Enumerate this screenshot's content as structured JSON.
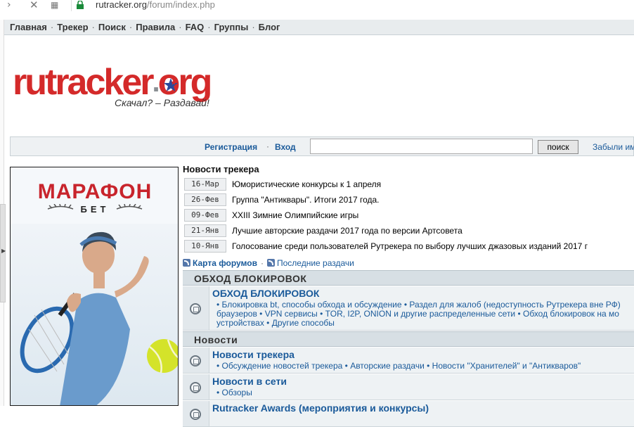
{
  "browser": {
    "url_host": "rutracker.org",
    "url_path": "/forum/index.php"
  },
  "topmenu": {
    "items": [
      "Главная",
      "Трекер",
      "Поиск",
      "Правила",
      "FAQ",
      "Группы",
      "Блог"
    ]
  },
  "logo": {
    "text_red": "rutracker",
    "text_grey": "org",
    "slogan": "Скачал? – Раздавай!"
  },
  "loginbar": {
    "register": "Регистрация",
    "login": "Вход",
    "search_button": "поиск",
    "forgot": "Забыли им"
  },
  "ad": {
    "brand": "МАРАФОН",
    "sub": "БЕТ"
  },
  "news": {
    "heading": "Новости трекера",
    "items": [
      {
        "date": "16-Мар",
        "title": "Юмористические конкурсы к 1 апреля"
      },
      {
        "date": "26-Фев",
        "title": "Группа \"Антиквары\". Итоги 2017 года."
      },
      {
        "date": "09-Фев",
        "title": "XXIII Зимние Олимпийские игры"
      },
      {
        "date": "21-Янв",
        "title": "Лучшие авторские раздачи 2017 года по версии Артсовета"
      },
      {
        "date": "10-Янв",
        "title": "Голосование среди пользователей Рутрекера по выбору лучших джазовых изданий 2017 г"
      }
    ]
  },
  "maplinks": {
    "forum_map": "Карта форумов",
    "latest": "Последние раздачи"
  },
  "categories": [
    {
      "title": "ОБХОД БЛОКИРОВОК",
      "forums": [
        {
          "name": "ОБХОД БЛОКИРОВОК",
          "lines": [
            "• Блокировка bt, способы обхода и обсуждение • Раздел для жалоб (недоступность Рутрекера вне РФ)",
            "браузеров • VPN сервисы • TOR, I2P, ONION и другие распределенные сети • Обход блокировок на мо",
            "устройствах • Другие способы"
          ]
        }
      ]
    },
    {
      "title": "Новости",
      "forums": [
        {
          "name": "Новости трекера",
          "lines": [
            "• Обсуждение новостей трекера • Авторские раздачи • Новости \"Хранителей\" и \"Антикваров\""
          ]
        },
        {
          "name": "Новости в сети",
          "lines": [
            "• Обзоры"
          ]
        },
        {
          "name": "Rutracker Awards (мероприятия и конкурсы)",
          "lines": []
        }
      ]
    }
  ]
}
